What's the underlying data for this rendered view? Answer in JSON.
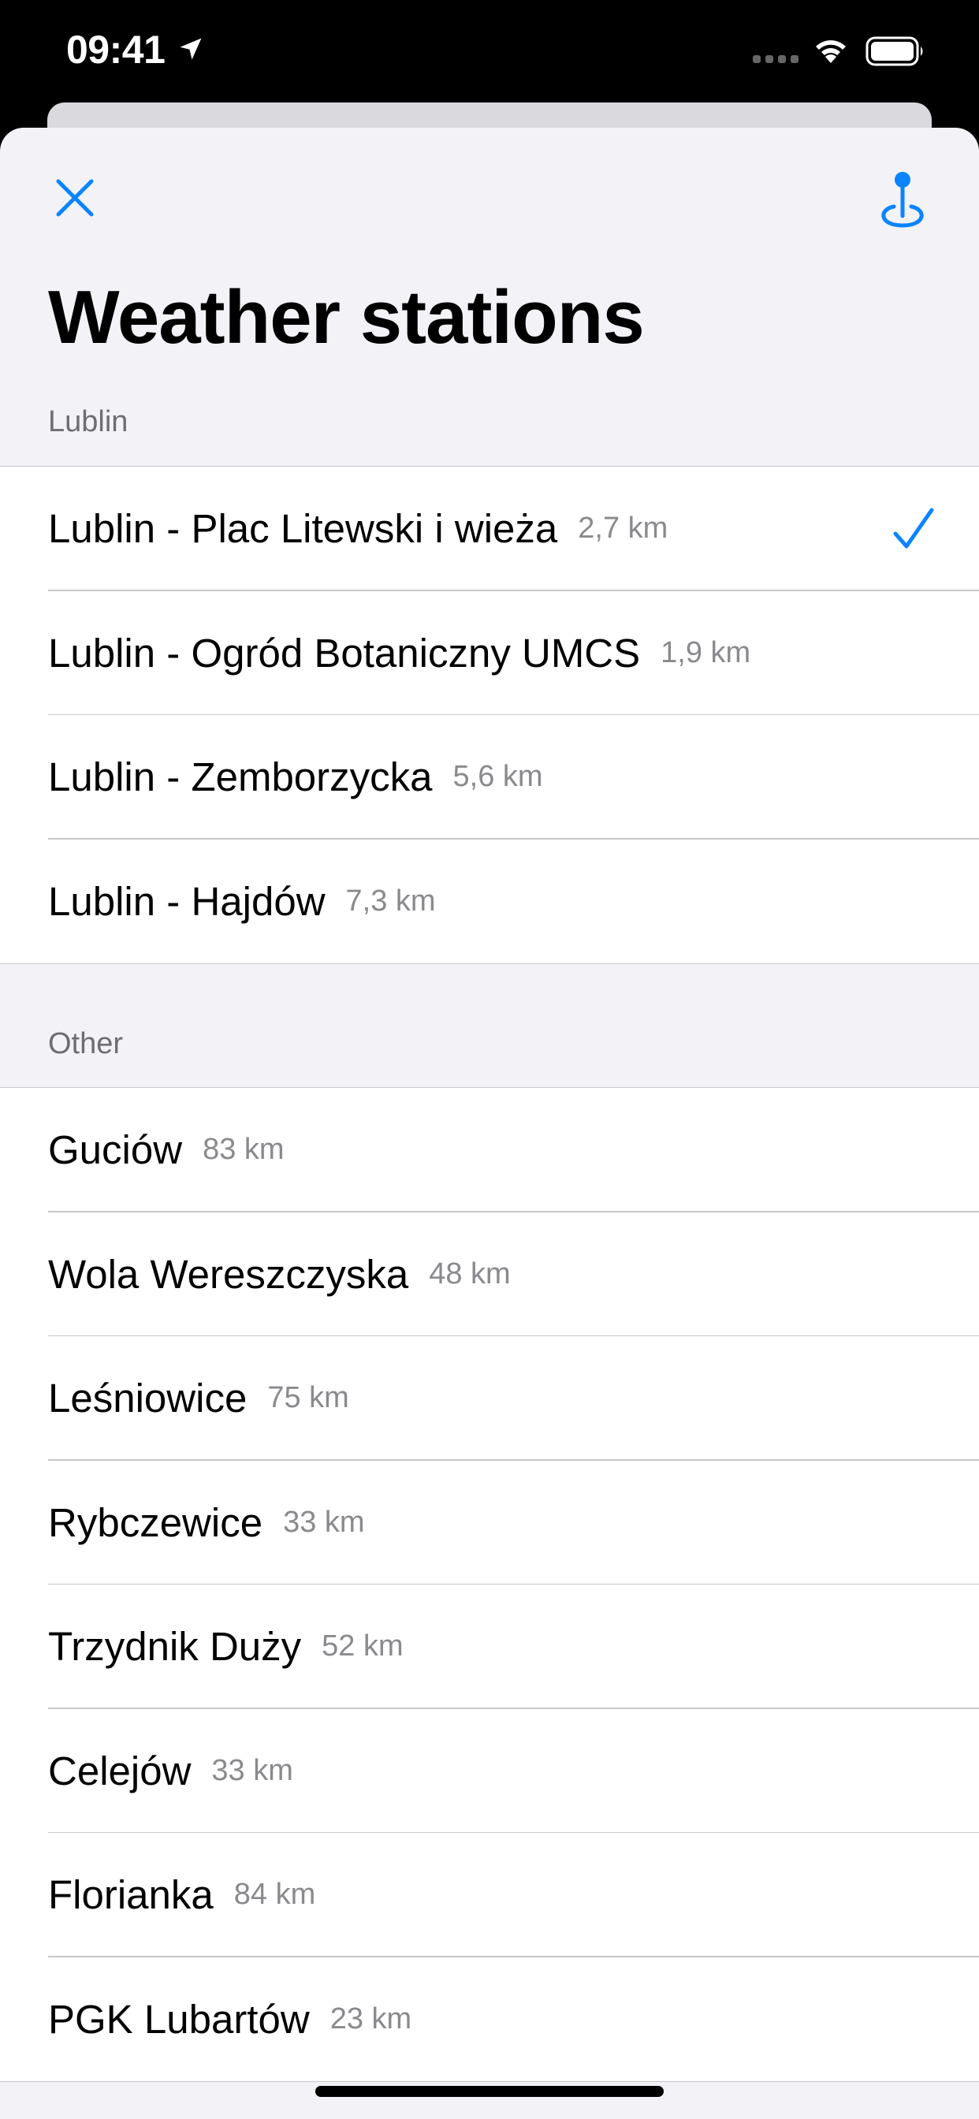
{
  "status_bar": {
    "time": "09:41",
    "icons": [
      "location-arrow-icon",
      "signal-icon",
      "wifi-icon",
      "battery-icon"
    ]
  },
  "navigation": {
    "close_icon": "close-icon",
    "locate_icon": "map-pin-icon",
    "title": "Weather stations"
  },
  "sections": [
    {
      "header": "Lublin",
      "rows": [
        {
          "name": "Lublin - Plac Litewski i wieża",
          "distance": "2,7 km",
          "selected": true
        },
        {
          "name": "Lublin - Ogród Botaniczny UMCS",
          "distance": "1,9 km",
          "selected": false
        },
        {
          "name": "Lublin - Zemborzycka",
          "distance": "5,6 km",
          "selected": false
        },
        {
          "name": "Lublin - Hajdów",
          "distance": "7,3 km",
          "selected": false
        }
      ]
    },
    {
      "header": "Other",
      "rows": [
        {
          "name": "Guciów",
          "distance": "83 km"
        },
        {
          "name": "Wola Wereszczyska",
          "distance": "48 km"
        },
        {
          "name": "Leśniowice",
          "distance": "75 km"
        },
        {
          "name": "Rybczewice",
          "distance": "33 km"
        },
        {
          "name": "Trzydnik Duży",
          "distance": "52 km"
        },
        {
          "name": "Celejów",
          "distance": "33 km"
        },
        {
          "name": "Florianka",
          "distance": "84 km"
        },
        {
          "name": "PGK Lubartów",
          "distance": "23 km"
        }
      ]
    }
  ],
  "colors": {
    "accent": "#0a84ff",
    "background": "#f2f2f7",
    "secondary_text": "#8a8a8e",
    "section_header": "#6d6d72"
  }
}
